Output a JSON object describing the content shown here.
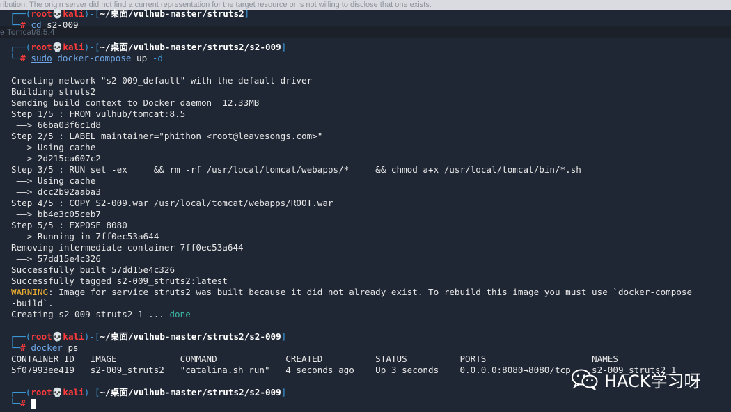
{
  "background_notices": {
    "top": "ribution: The origin server did not find a current representation for the target resource or is not willing to disclose that one exists.",
    "second": "e Tomcat/8.5.4"
  },
  "prompt": {
    "user": "root",
    "host": "kali",
    "path1": "~/桌面/vulhub-master/struts2",
    "path2": "~/桌面/vulhub-master/struts2/s2-009",
    "hash": "#"
  },
  "commands": {
    "cd": "cd",
    "cd_arg": "s2-009",
    "sudo": "sudo",
    "compose": "docker-compose",
    "up": "up",
    "flag": "-d",
    "docker": "docker",
    "ps": "ps"
  },
  "output": [
    "Creating network \"s2-009_default\" with the default driver",
    "Building struts2",
    "Sending build context to Docker daemon  12.33MB",
    "Step 1/5 : FROM vulhub/tomcat:8.5",
    " ——> 66ba03f6c1d8",
    "Step 2/5 : LABEL maintainer=\"phithon <root@leavesongs.com>\"",
    " ——> Using cache",
    " ——> 2d215ca607c2",
    "Step 3/5 : RUN set -ex     && rm -rf /usr/local/tomcat/webapps/*     && chmod a+x /usr/local/tomcat/bin/*.sh",
    " ——> Using cache",
    " ——> dcc2b92aaba3",
    "Step 4/5 : COPY S2-009.war /usr/local/tomcat/webapps/ROOT.war",
    " ——> bb4e3c05ceb7",
    "Step 5/5 : EXPOSE 8080",
    " ——> Running in 7ff0ec53a644",
    "Removing intermediate container 7ff0ec53a644",
    " ——> 57dd15e4c326",
    "Successfully built 57dd15e4c326",
    "Successfully tagged s2-009_struts2:latest"
  ],
  "warning": {
    "label": "WARNING",
    "text": ": Image for service struts2 was built because it did not already exist. To rebuild this image you must use `docker-compose",
    "cont": "-build`."
  },
  "creating": {
    "text": "Creating s2-009_struts2_1 ... ",
    "status": "done"
  },
  "ps_table": {
    "header": "CONTAINER ID   IMAGE            COMMAND             CREATED          STATUS          PORTS                    NAMES",
    "row": "5f07993ee419   s2-009_struts2   \"catalina.sh run\"   4 seconds ago    Up 3 seconds    0.0.0.0:8080→8080/tcp    s2-009_struts2_1"
  },
  "watermark": {
    "text": "HACK学习呀",
    "icon": "wechat-icon"
  }
}
